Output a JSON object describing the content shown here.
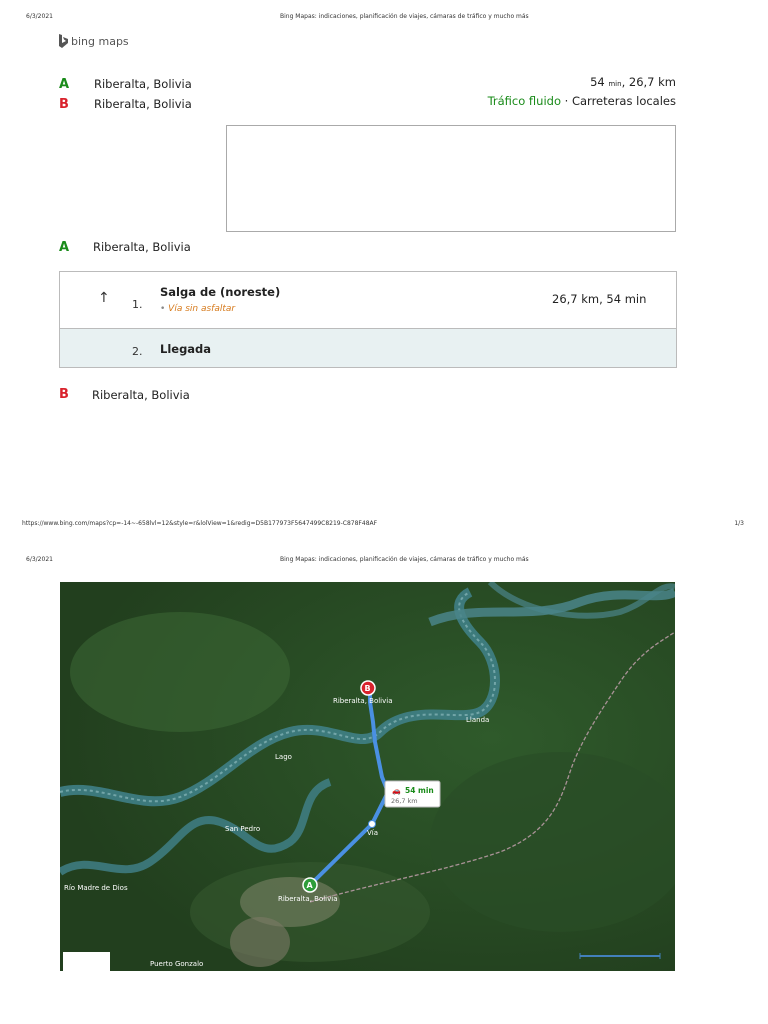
{
  "page1": {
    "date": "6/3/2021",
    "title": "Bing Mapas: indicaciones, planificación de viajes, cámaras de tráfico y mucho más",
    "logo_text": "bing maps",
    "waypoints": [
      {
        "letter": "A",
        "name": "Riberalta, Bolivia"
      },
      {
        "letter": "B",
        "name": "Riberalta, Bolivia"
      }
    ],
    "summary": {
      "time_value": "54",
      "time_unit": "min",
      "distance": ", 26,7 km",
      "traffic": "Tráfico fluido",
      "separator": " · ",
      "road_type": "Carreteras locales"
    },
    "start": {
      "letter": "A",
      "name": "Riberalta, Bolivia"
    },
    "steps": [
      {
        "number": "1.",
        "instruction": "Salga de (noreste)",
        "note": "Vía sin asfaltar",
        "distance": "26,7 km, 54 min"
      },
      {
        "number": "2.",
        "instruction": "Llegada"
      }
    ],
    "end": {
      "letter": "B",
      "name": "Riberalta, Bolivia"
    },
    "footer_url": "https://www.bing.com/maps?cp=-14~-658lvl=12&style=r&lolView=1&redig=D5B177973F5647499C8219-C878F48AF",
    "page_number": "1/3"
  },
  "page2": {
    "date": "6/3/2021",
    "title": "Bing Mapas: indicaciones, planificación de viajes, cámaras de tráfico y mucho más",
    "map": {
      "callout_time": "54 min",
      "callout_distance": "26,7 km",
      "labels": {
        "b_city": "Riberalta, Bolivia",
        "a_city": "Riberalta, Bolivia",
        "llanda": "Llanda",
        "san_pedro": "San Pedro",
        "via": "Vía",
        "lago": "Lago",
        "madre": "Río Madre de Dios",
        "puerto": "Puerto Gonzalo"
      },
      "colors": {
        "route": "#4a90e2",
        "pin_a": "#2e9d3a",
        "pin_b": "#d9232d",
        "time": "#1a8b1a"
      }
    }
  }
}
